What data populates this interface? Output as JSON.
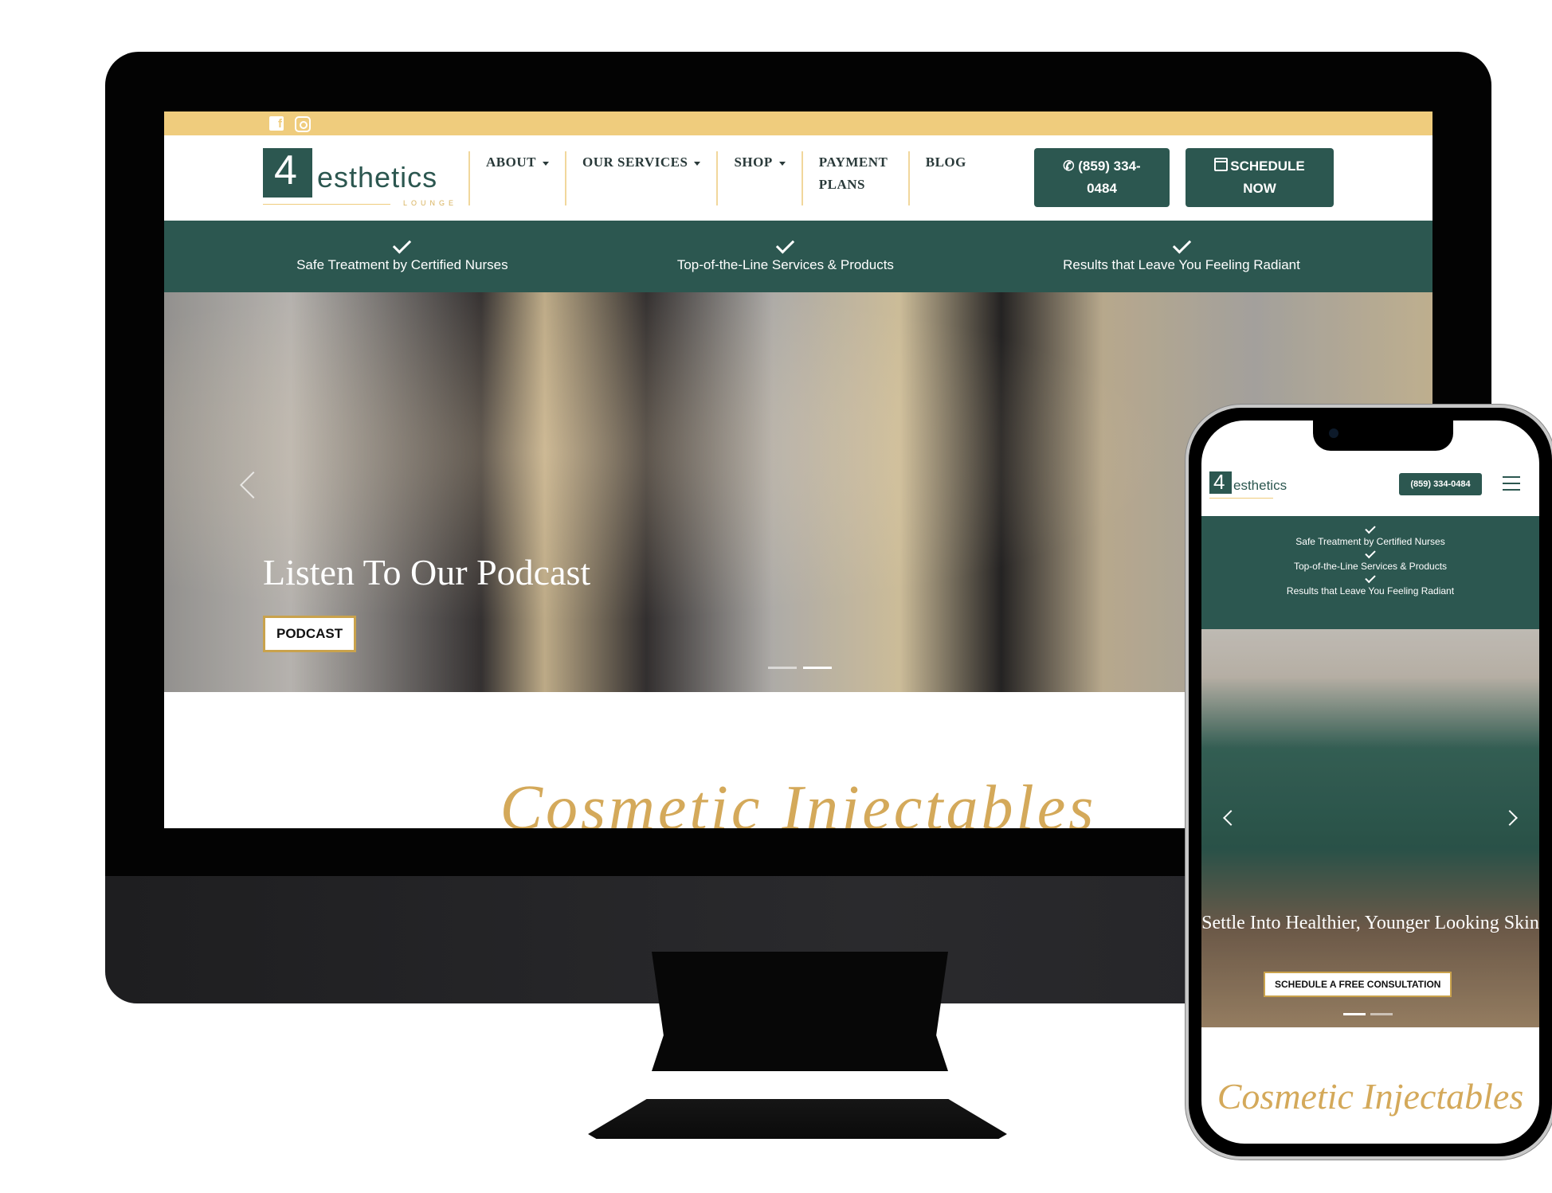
{
  "desktop": {
    "topbar": {
      "social": [
        {
          "icon": "facebook-icon",
          "glyph": "f"
        },
        {
          "icon": "instagram-icon",
          "glyph": ""
        }
      ]
    },
    "brand": {
      "four": "4",
      "name": "esthetics",
      "tagline": "LOUNGE"
    },
    "nav": [
      {
        "label": "ABOUT",
        "dropdown": true
      },
      {
        "label": "OUR SERVICES",
        "dropdown": true
      },
      {
        "label": "SHOP",
        "dropdown": true
      },
      {
        "label": "PAYMENT PLANS",
        "dropdown": false
      },
      {
        "label": "BLOG",
        "dropdown": false
      }
    ],
    "phone_button": {
      "icon": "phone-icon",
      "glyph": "✆",
      "label": "(859) 334-0484"
    },
    "schedule_button": {
      "icon": "calendar-icon",
      "label": "SCHEDULE NOW"
    },
    "benefits": [
      "Safe Treatment by Certified Nurses",
      "Top-of-the-Line Services & Products",
      "Results that Leave You Feeling Radiant"
    ],
    "hero": {
      "title": "Listen To Our Podcast",
      "button": "PODCAST",
      "slides": 2,
      "active_slide": 2
    },
    "section_heading": "Cosmetic Injectables"
  },
  "mobile": {
    "brand": {
      "four": "4",
      "name": "esthetics"
    },
    "call_button": "(859) 334-0484",
    "menu_icon": "hamburger-menu-icon",
    "benefits": [
      "Safe Treatment by Certified Nurses",
      "Top-of-the-Line Services & Products",
      "Results that Leave You Feeling Radiant"
    ],
    "hero": {
      "title": "Settle Into Healthier, Younger Looking Skin",
      "button": "SCHEDULE A FREE CONSULTATION",
      "slides": 2,
      "active_slide": 1
    },
    "section_heading": "Cosmetic Injectables"
  },
  "colors": {
    "brand_green": "#2c5750",
    "gold": "#efcc7d",
    "script_gold": "#d4a95a"
  }
}
